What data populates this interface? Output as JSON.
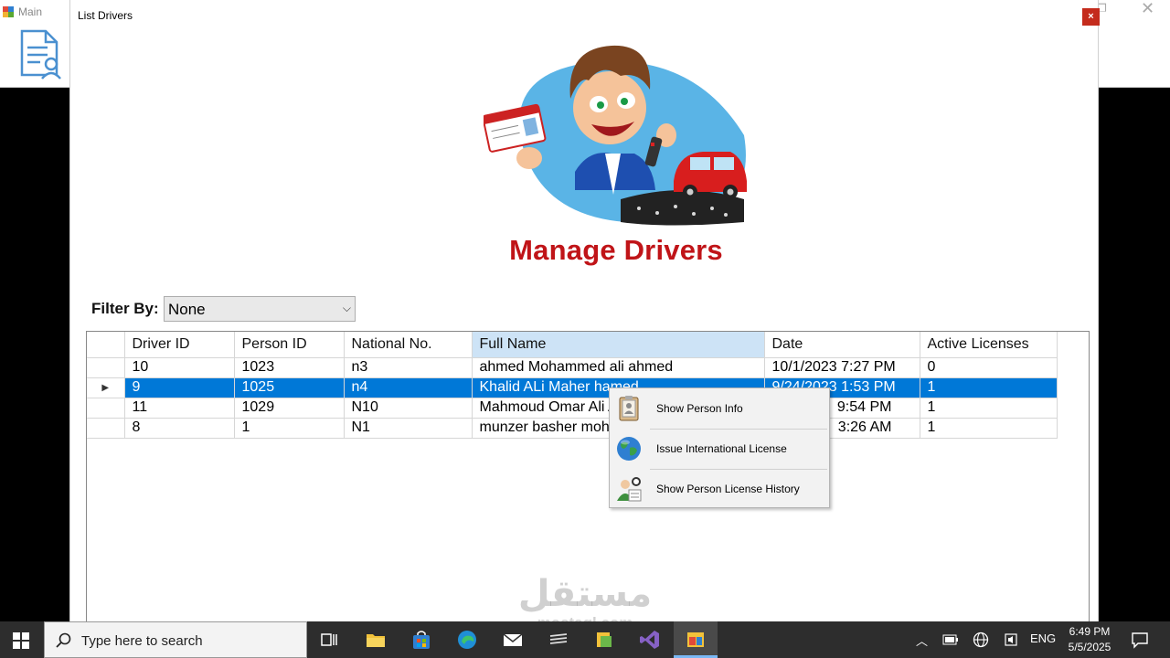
{
  "main_window": {
    "title": "Main"
  },
  "dialog": {
    "title": "List Drivers",
    "close_label": "×",
    "heading": "Manage Drivers",
    "filter": {
      "label": "Filter By:",
      "value": "None"
    }
  },
  "grid": {
    "columns": [
      "Driver ID",
      "Person ID",
      "National No.",
      "Full Name",
      "Date",
      "Active Licenses"
    ],
    "sorted_column": "Full Name",
    "rows": [
      [
        "10",
        "1023",
        "n3",
        "ahmed Mohammed ali ahmed",
        "10/1/2023 7:27 PM",
        "0"
      ],
      [
        "9",
        "1025",
        "n4",
        "Khalid ALi Maher hamed",
        "9/24/2023 1:53 PM",
        "1"
      ],
      [
        "11",
        "1029",
        "N10",
        "Mahmoud Omar Ali A",
        "9:54 PM",
        "1"
      ],
      [
        "8",
        "1",
        "N1",
        "munzer basher moha",
        "3:26 AM",
        "1"
      ]
    ],
    "selected_row_index": 1,
    "row_indicator": "▶"
  },
  "context_menu": {
    "items": [
      {
        "label": "Show Person Info",
        "icon": "person-card-icon"
      },
      {
        "label": "Issue International License",
        "icon": "globe-icon"
      },
      {
        "label": "Show Person License History",
        "icon": "person-history-icon"
      }
    ]
  },
  "watermark": {
    "arabic": "مستقل",
    "latin": "mostaql.com"
  },
  "taskbar": {
    "search_placeholder": "Type here to search",
    "language": "ENG",
    "time": "6:49 PM",
    "date": "5/5/2025"
  },
  "colors": {
    "selection": "#0078d7",
    "heading": "#c01418",
    "close_button": "#c42b1c",
    "taskbar": "#2d2d2d"
  }
}
